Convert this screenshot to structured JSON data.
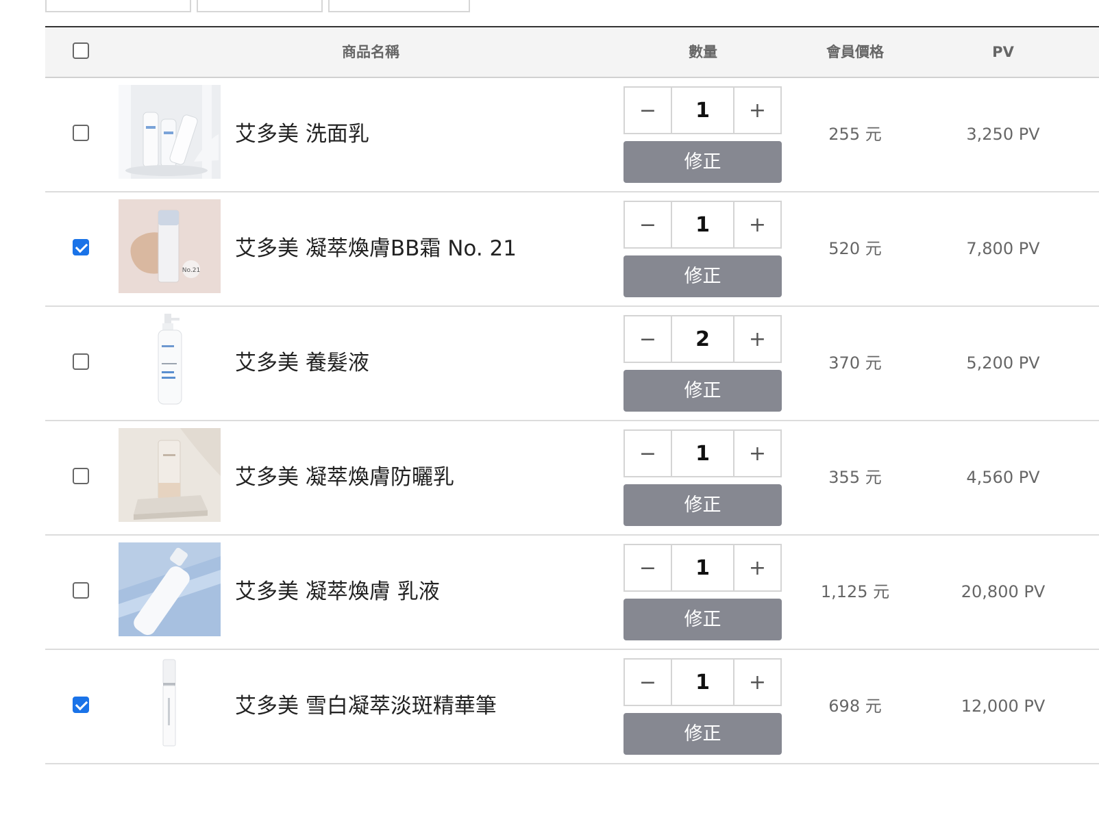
{
  "header": {
    "product_name": "商品名稱",
    "quantity": "數量",
    "member_price": "會員價格",
    "pv": "PV"
  },
  "select_all_checked": false,
  "items": [
    {
      "name": "艾多美 洗面乳",
      "checked": false,
      "quantity": "1",
      "fix_label": "修正",
      "price": "255 元",
      "pv": "3,250 PV",
      "image": "cleanser-product-photo"
    },
    {
      "name": "艾多美 凝萃煥膚BB霜 No. 21",
      "checked": true,
      "quantity": "1",
      "fix_label": "修正",
      "price": "520 元",
      "pv": "7,800 PV",
      "image": "bb-cream-product-photo",
      "image_label": "No.21"
    },
    {
      "name": "艾多美 養髮液",
      "checked": false,
      "quantity": "2",
      "fix_label": "修正",
      "price": "370 元",
      "pv": "5,200 PV",
      "image": "hair-tonic-product-photo"
    },
    {
      "name": "艾多美 凝萃煥膚防曬乳",
      "checked": false,
      "quantity": "1",
      "fix_label": "修正",
      "price": "355 元",
      "pv": "4,560 PV",
      "image": "sunscreen-product-photo"
    },
    {
      "name": "艾多美 凝萃煥膚 乳液",
      "checked": false,
      "quantity": "1",
      "fix_label": "修正",
      "price": "1,125 元",
      "pv": "20,800 PV",
      "image": "emulsion-product-photo"
    },
    {
      "name": "艾多美 雪白凝萃淡斑精華筆",
      "checked": true,
      "quantity": "1",
      "fix_label": "修正",
      "price": "698 元",
      "pv": "12,000 PV",
      "image": "serum-pen-product-photo"
    }
  ],
  "icons": {
    "minus": "minus-icon",
    "plus": "plus-icon",
    "check": "check-icon"
  },
  "colors": {
    "checkbox_checked": "#1a73e8",
    "fix_button": "#868891",
    "header_bg": "#f4f4f4"
  }
}
